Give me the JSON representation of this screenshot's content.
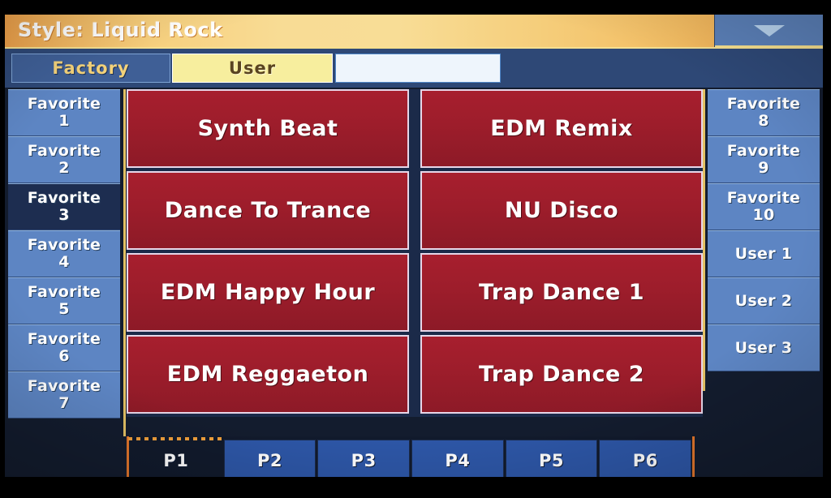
{
  "titlebar": {
    "title": "Style: Liquid Rock",
    "dropdown_icon": "chevron-down-icon",
    "accent_color": "#f0b45e",
    "text_color": "#ffffff"
  },
  "tabs": [
    {
      "label": "Factory",
      "selected": false
    },
    {
      "label": "User",
      "selected": true
    },
    {
      "label": "",
      "selected": false
    }
  ],
  "sidebar_left": {
    "items": [
      {
        "line1": "Favorite",
        "line2": "1",
        "selected": false
      },
      {
        "line1": "Favorite",
        "line2": "2",
        "selected": false
      },
      {
        "line1": "Favorite",
        "line2": "3",
        "selected": true
      },
      {
        "line1": "Favorite",
        "line2": "4",
        "selected": false
      },
      {
        "line1": "Favorite",
        "line2": "5",
        "selected": false
      },
      {
        "line1": "Favorite",
        "line2": "6",
        "selected": false
      },
      {
        "line1": "Favorite",
        "line2": "7",
        "selected": false
      }
    ]
  },
  "sidebar_right": {
    "items": [
      {
        "line1": "Favorite",
        "line2": "8",
        "selected": false
      },
      {
        "line1": "Favorite",
        "line2": "9",
        "selected": false
      },
      {
        "line1": "Favorite",
        "line2": "10",
        "selected": false
      },
      {
        "line1": "User 1",
        "line2": "",
        "selected": false
      },
      {
        "line1": "User 2",
        "line2": "",
        "selected": false
      },
      {
        "line1": "User 3",
        "line2": "",
        "selected": false
      }
    ]
  },
  "styles": {
    "rows": [
      {
        "left": "Synth Beat",
        "right": "EDM Remix"
      },
      {
        "left": "Dance To Trance",
        "right": "NU Disco"
      },
      {
        "left": "EDM Happy Hour",
        "right": "Trap Dance 1"
      },
      {
        "left": "EDM Reggaeton",
        "right": "Trap Dance 2"
      }
    ],
    "button_color": "#9d1d2b",
    "label_color": "#ffffff"
  },
  "page_tabs": {
    "items": [
      {
        "label": "P1",
        "selected": true
      },
      {
        "label": "P2",
        "selected": false
      },
      {
        "label": "P3",
        "selected": false
      },
      {
        "label": "P4",
        "selected": false
      },
      {
        "label": "P5",
        "selected": false
      },
      {
        "label": "P6",
        "selected": false
      }
    ],
    "marker_color": "#f0a03c"
  }
}
